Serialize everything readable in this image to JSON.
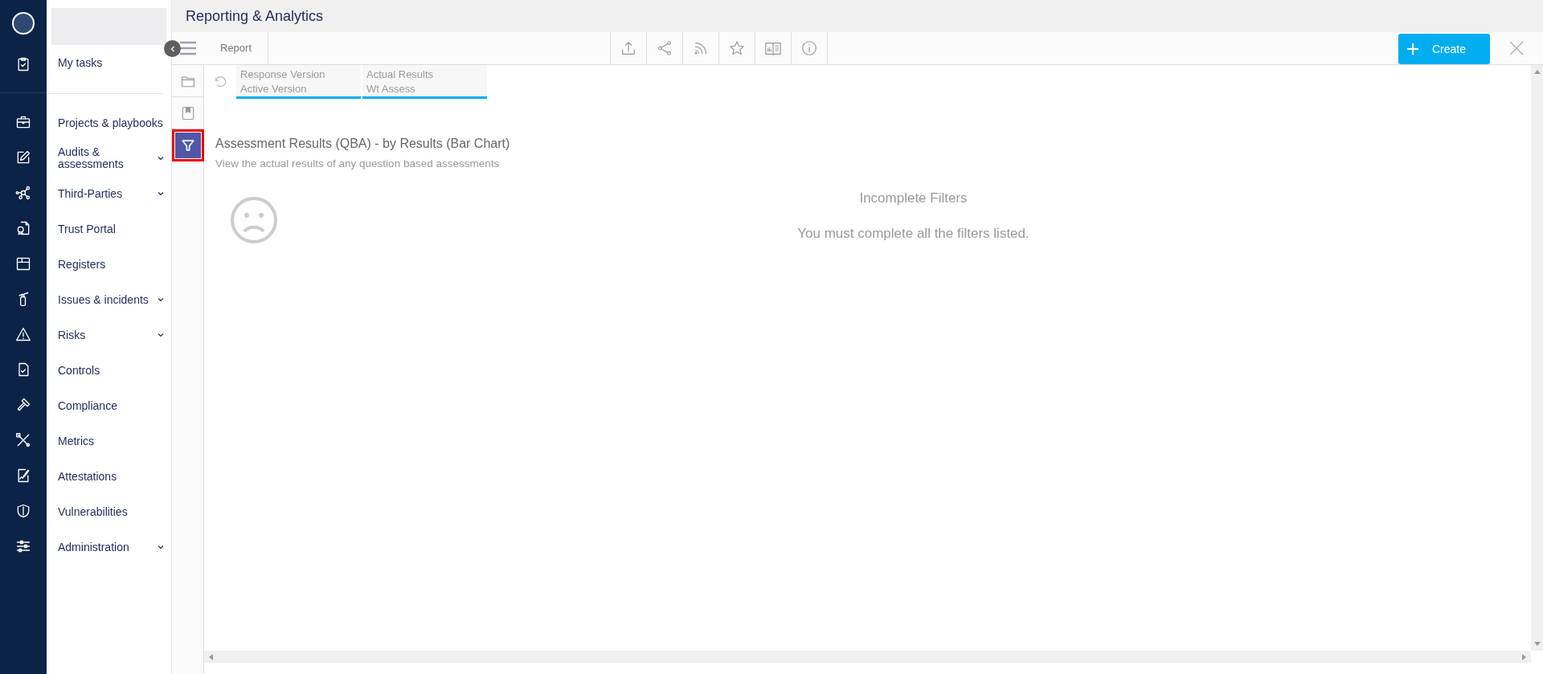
{
  "header": {
    "title": "Reporting & Analytics"
  },
  "sidebar": {
    "top_items": [
      {
        "label": "My tasks",
        "has_submenu": false
      }
    ],
    "items": [
      {
        "label": "Projects & playbooks",
        "has_submenu": false
      },
      {
        "label": "Audits & assessments",
        "has_submenu": true
      },
      {
        "label": "Third-Parties",
        "has_submenu": true
      },
      {
        "label": "Trust Portal",
        "has_submenu": false
      },
      {
        "label": "Registers",
        "has_submenu": false
      },
      {
        "label": "Issues & incidents",
        "has_submenu": true
      },
      {
        "label": "Risks",
        "has_submenu": true
      },
      {
        "label": "Controls",
        "has_submenu": false
      },
      {
        "label": "Compliance",
        "has_submenu": false
      },
      {
        "label": "Metrics",
        "has_submenu": false
      },
      {
        "label": "Attestations",
        "has_submenu": false
      },
      {
        "label": "Vulnerabilities",
        "has_submenu": false
      },
      {
        "label": "Administration",
        "has_submenu": true
      }
    ]
  },
  "toolbar": {
    "tab": "Report",
    "create_button": "Create"
  },
  "tools": [
    {
      "kind": "folder",
      "selected": false,
      "highlighted": false
    },
    {
      "kind": "bookmark",
      "selected": false,
      "highlighted": false
    },
    {
      "kind": "filter",
      "selected": true,
      "highlighted": true
    }
  ],
  "filters": [
    {
      "name": "Response Version",
      "value": "Active Version"
    },
    {
      "name": "Actual Results",
      "value": "Wt Assess"
    }
  ],
  "report": {
    "title": "Assessment Results (QBA) - by Results (Bar Chart)",
    "description": "View the actual results of any question based assessments"
  },
  "message": {
    "title": "Incomplete Filters",
    "text": "You must complete all the filters listed."
  }
}
